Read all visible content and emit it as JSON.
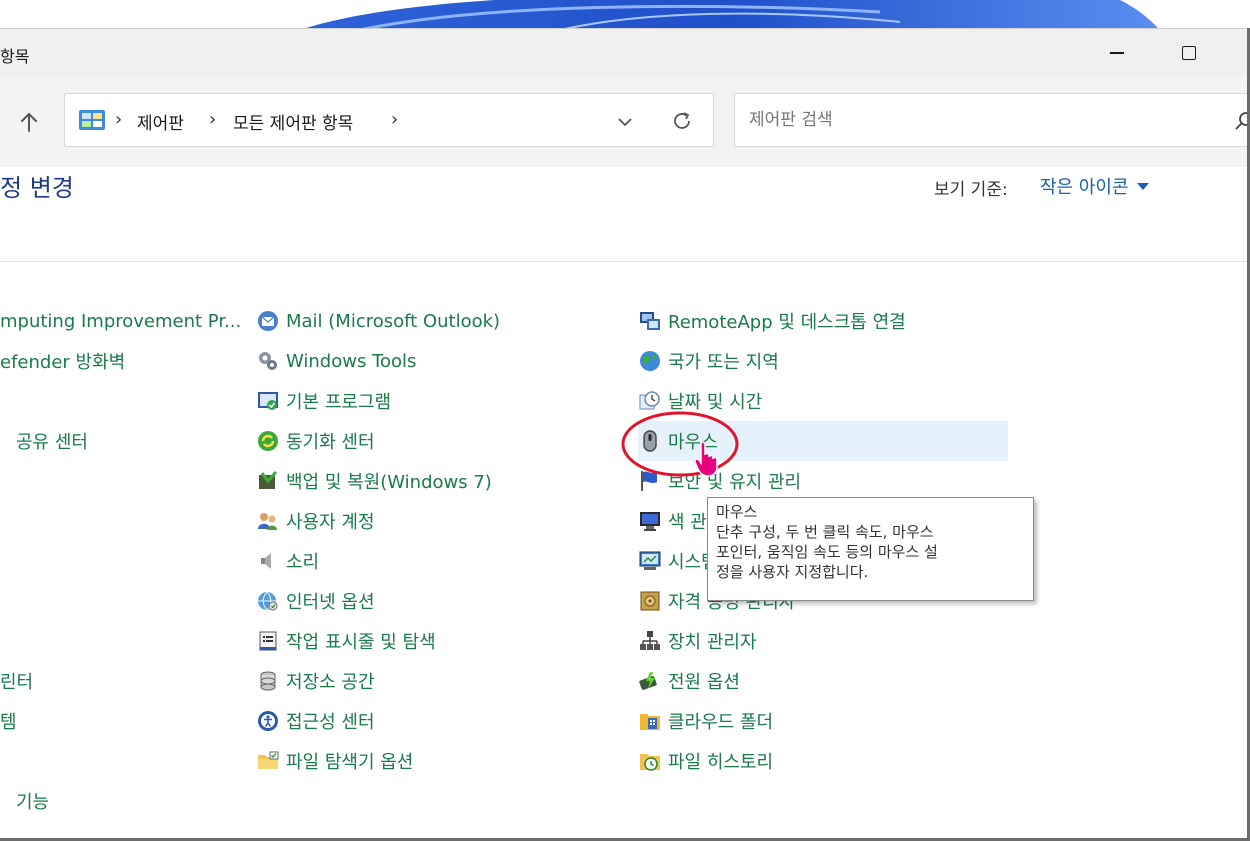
{
  "window": {
    "title": "항목",
    "minimize_label": "",
    "maximize_label": ""
  },
  "address_bar": {
    "crumbs": [
      "제어판",
      "모든 제어판 항목"
    ]
  },
  "search": {
    "placeholder": "제어판 검색"
  },
  "heading": "정 변경",
  "view": {
    "label": "보기 기준:",
    "value": "작은 아이콘"
  },
  "columns": {
    "left": [
      {
        "label": "mputing Improvement Pr..."
      },
      {
        "label": "efender 방화벽"
      },
      {
        "label": "공유 센터"
      },
      {
        "label": "린터"
      },
      {
        "label": "템"
      },
      {
        "label": "기능"
      }
    ],
    "middle": [
      {
        "label": "Mail (Microsoft Outlook)",
        "icon": "mail-icon"
      },
      {
        "label": "Windows Tools",
        "icon": "windows-tools-icon"
      },
      {
        "label": "기본 프로그램",
        "icon": "default-programs-icon"
      },
      {
        "label": "동기화 센터",
        "icon": "sync-center-icon"
      },
      {
        "label": "백업 및 복원(Windows 7)",
        "icon": "backup-restore-icon"
      },
      {
        "label": "사용자 계정",
        "icon": "user-accounts-icon"
      },
      {
        "label": "소리",
        "icon": "sound-icon"
      },
      {
        "label": "인터넷 옵션",
        "icon": "internet-options-icon"
      },
      {
        "label": "작업 표시줄 및 탐색",
        "icon": "taskbar-icon"
      },
      {
        "label": "저장소 공간",
        "icon": "storage-spaces-icon"
      },
      {
        "label": "접근성 센터",
        "icon": "ease-of-access-icon"
      },
      {
        "label": "파일 탐색기 옵션",
        "icon": "file-explorer-options-icon"
      }
    ],
    "right": [
      {
        "label": "RemoteApp 및 데스크톱 연결",
        "icon": "remoteapp-icon"
      },
      {
        "label": "국가 또는 지역",
        "icon": "region-icon"
      },
      {
        "label": "날짜 및 시간",
        "icon": "date-time-icon"
      },
      {
        "label": "마우스",
        "icon": "mouse-icon"
      },
      {
        "label": "보안 및 유지 관리",
        "icon": "security-maintenance-icon"
      },
      {
        "label": "색 관리",
        "icon": "color-management-icon"
      },
      {
        "label": "시스템",
        "icon": "system-icon"
      },
      {
        "label": "자격 증명 관리자",
        "icon": "credential-manager-icon"
      },
      {
        "label": "장치 관리자",
        "icon": "device-manager-icon"
      },
      {
        "label": "전원 옵션",
        "icon": "power-options-icon"
      },
      {
        "label": "클라우드 폴더",
        "icon": "work-folders-icon"
      },
      {
        "label": "파일 히스토리",
        "icon": "file-history-icon"
      }
    ]
  },
  "tooltip": {
    "title": "마우스",
    "lines": [
      "단추 구성, 두 번 클릭 속도, 마우스",
      "포인터, 움직임 속도 등의 마우스 설",
      "정을 사용자 지정합니다."
    ]
  },
  "colors": {
    "link_green": "#1a7a4a",
    "heading_blue": "#1e3a8a",
    "accent_blue": "#1a5fb4",
    "hover_bg": "#e5f1fb",
    "annotation_red": "#e0142a"
  }
}
